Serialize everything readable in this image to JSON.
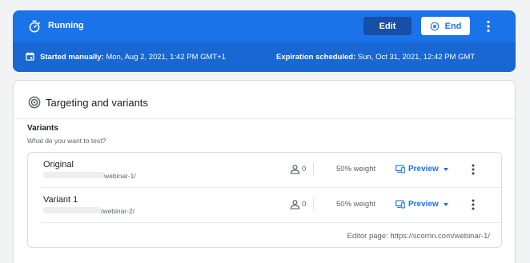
{
  "status": {
    "label": "Running",
    "edit_label": "Edit",
    "end_label": "End",
    "started_label": "Started manually:",
    "started_value": "Mon, Aug 2, 2021, 1:42 PM GMT+1",
    "expiry_label": "Expiration scheduled:",
    "expiry_value": "Sun, Oct 31, 2021, 12:42 PM GMT",
    "colors": {
      "primary": "#1a73e8",
      "primary_dark": "#1967d2",
      "edit_bg": "#174ea6"
    }
  },
  "targeting": {
    "title": "Targeting and variants",
    "variants_title": "Variants",
    "variants_subtitle": "What do you want to test?",
    "variants": [
      {
        "name": "Original",
        "url_suffix": "webinar-1/",
        "count": "0",
        "weight": "50% weight",
        "preview_label": "Preview"
      },
      {
        "name": "Variant 1",
        "url_suffix": "/webinar-2/",
        "count": "0",
        "weight": "50% weight",
        "preview_label": "Preview"
      }
    ],
    "editor_page": "Editor page: https://scorrin.com/webinar-1/"
  }
}
